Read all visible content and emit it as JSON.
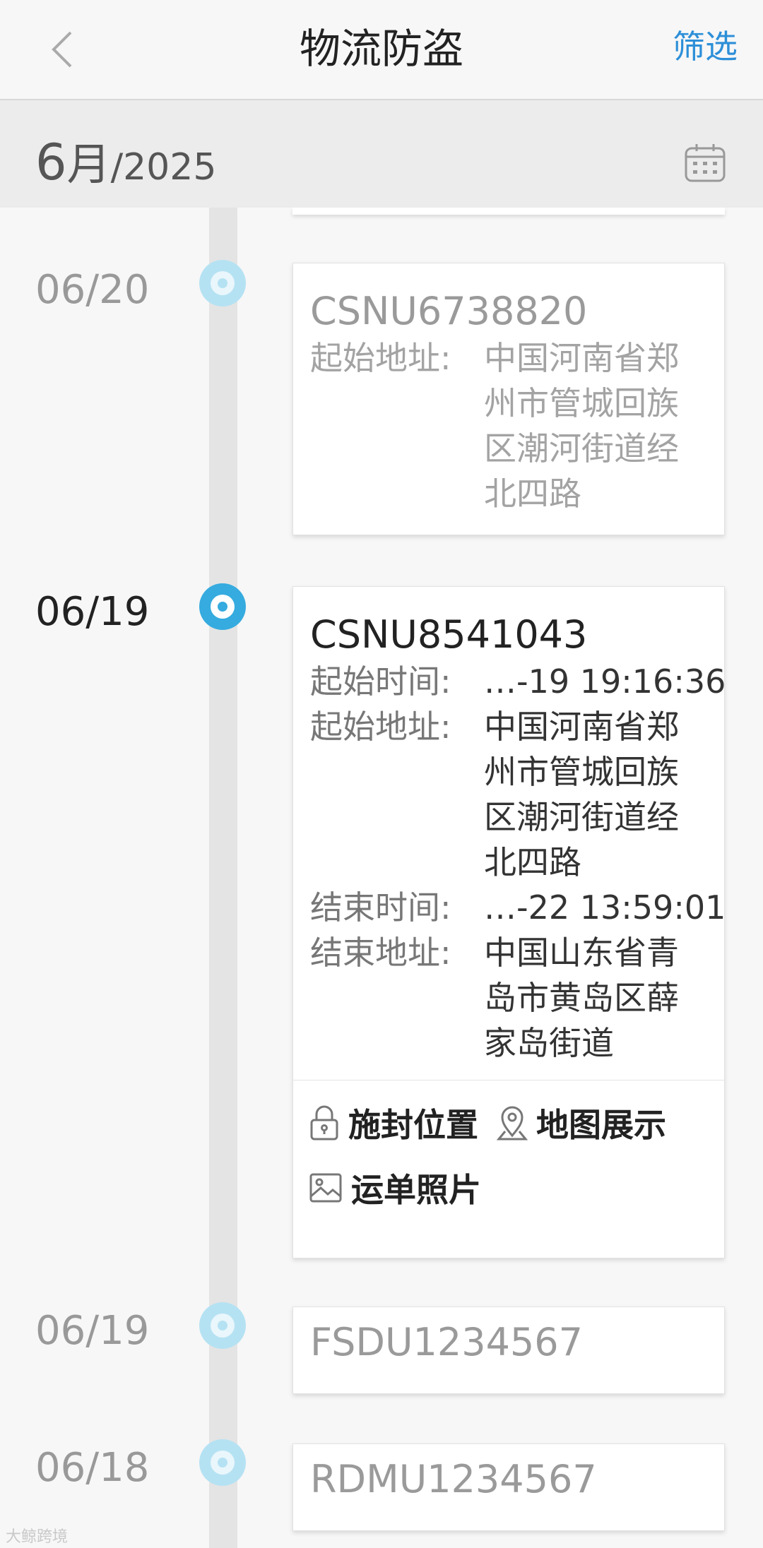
{
  "header": {
    "title": "物流防盗",
    "filter_label": "筛选"
  },
  "month_bar": {
    "month": "6",
    "month_unit": "月",
    "year": "/2025"
  },
  "entries": [
    {
      "date": "06/20",
      "id": "CSNU6738820",
      "start_address_label": "起始地址:",
      "start_address": "中国河南省郑州市管城回族区潮河街道经北四路"
    },
    {
      "date": "06/19",
      "id": "CSNU8541043",
      "start_time_label": "起始时间:",
      "start_time": "…-19 19:16:36",
      "start_address_label": "起始地址:",
      "start_address": "中国河南省郑州市管城回族区潮河街道经北四路",
      "end_time_label": "结束时间:",
      "end_time": "…-22 13:59:01",
      "end_address_label": "结束地址:",
      "end_address": "中国山东省青岛市黄岛区薛家岛街道",
      "actions": {
        "seal_location": "施封位置",
        "map_display": "地图展示",
        "waybill_photo": "运单照片"
      }
    },
    {
      "date": "06/19",
      "id": "FSDU1234567"
    },
    {
      "date": "06/18",
      "id": "RDMU1234567"
    }
  ],
  "icons": {
    "back": "chevron-left-icon",
    "calendar": "calendar-icon",
    "seal": "lock-icon",
    "map": "map-pin-icon",
    "photo": "image-icon"
  },
  "colors": {
    "accent": "#2d8fd8",
    "timeline_active": "#35abdf",
    "timeline_inactive": "#b5e2f3"
  },
  "watermark": "大鲸跨境"
}
